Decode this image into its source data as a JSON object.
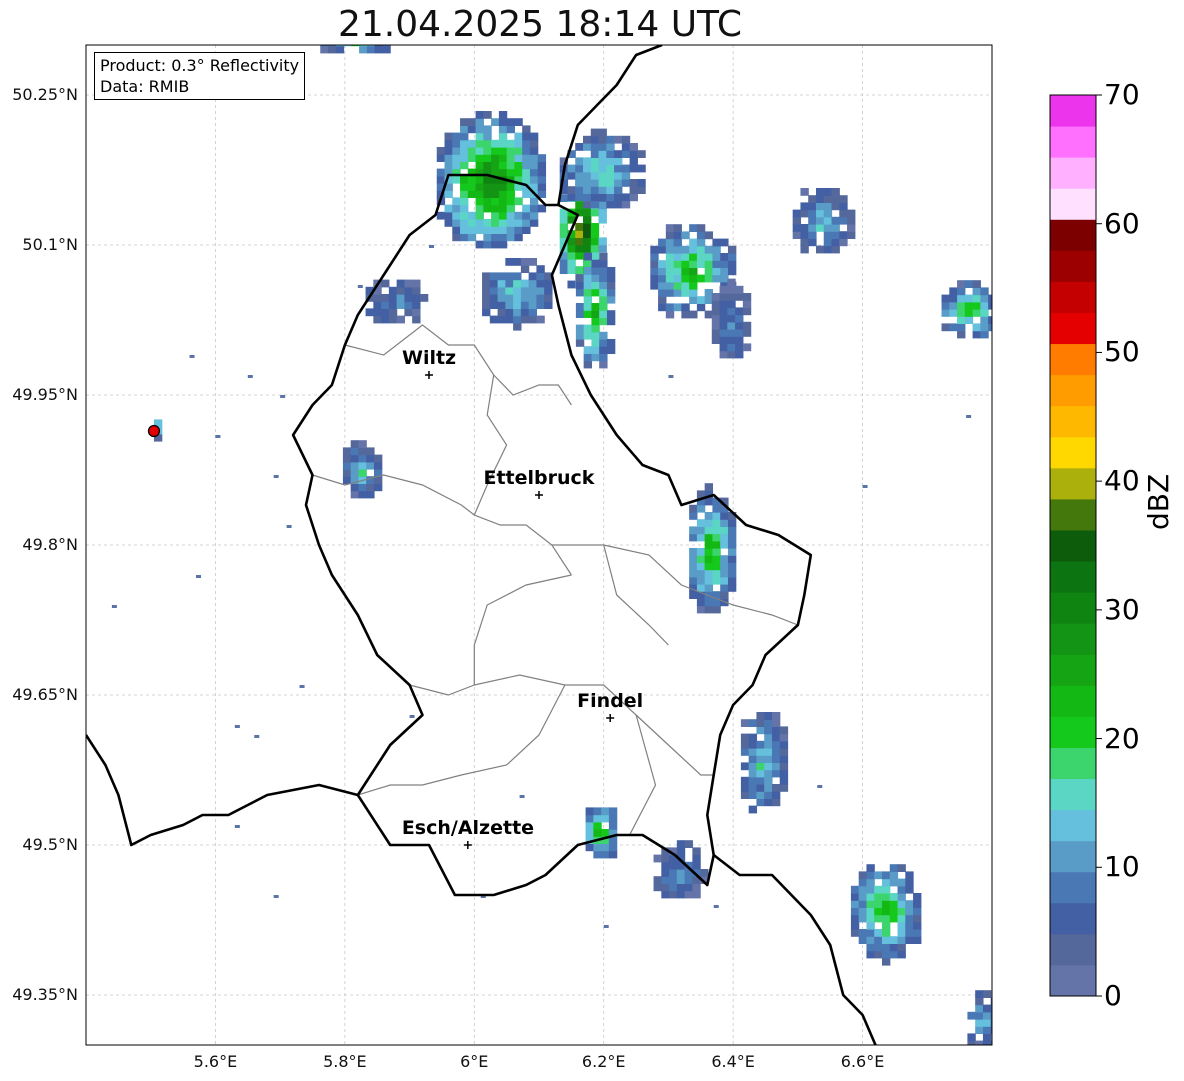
{
  "title": "21.04.2025 18:14 UTC",
  "info_box": {
    "product": "Product: 0.3° Reflectivity",
    "data_source": "Data: RMIB"
  },
  "axes": {
    "lat_labels": [
      "50.25°N",
      "50.1°N",
      "49.95°N",
      "49.8°N",
      "49.65°N",
      "49.5°N",
      "49.35°N"
    ],
    "lat_values": [
      50.25,
      50.1,
      49.95,
      49.8,
      49.65,
      49.5,
      49.35
    ],
    "lon_labels": [
      "5.6°E",
      "5.8°E",
      "6°E",
      "6.2°E",
      "6.4°E",
      "6.6°E"
    ],
    "lon_values": [
      5.6,
      5.8,
      6.0,
      6.2,
      6.4,
      6.6
    ],
    "lon_range": [
      5.4,
      6.8
    ],
    "lat_range": [
      49.3,
      50.3
    ],
    "grid": true
  },
  "cities": [
    {
      "name": "Wiltz",
      "lon": 5.93,
      "lat": 49.97
    },
    {
      "name": "Ettelbruck",
      "lon": 6.1,
      "lat": 49.85
    },
    {
      "name": "Findel",
      "lon": 6.21,
      "lat": 49.627
    },
    {
      "name": "Esch/Alzette",
      "lon": 5.99,
      "lat": 49.5
    }
  ],
  "radar_site": {
    "lon": 5.505,
    "lat": 49.914,
    "color": "#e00000"
  },
  "colorbar": {
    "label": "dBZ",
    "ticks": [
      "0",
      "10",
      "20",
      "30",
      "40",
      "50",
      "60",
      "70"
    ],
    "colors": [
      "#6474a8",
      "#54689c",
      "#4460a4",
      "#4a78b4",
      "#5a9cc8",
      "#64c0dc",
      "#5cd6c4",
      "#3cd46c",
      "#14c81c",
      "#14b814",
      "#14a414",
      "#149414",
      "#108410",
      "#0c7410",
      "#0c5c0c",
      "#44780c",
      "#acb00c",
      "#ffd800",
      "#ffb800",
      "#ff9c00",
      "#ff7c00",
      "#e40000",
      "#c40000",
      "#9c0000",
      "#7c0000",
      "#ffe0ff",
      "#ffb0ff",
      "#ff70ff",
      "#ec34ec"
    ]
  },
  "echo_cells": [
    {
      "lon": 6.02,
      "lat": 50.16,
      "rx": 0.09,
      "ry": 0.07,
      "max_dbz": 32
    },
    {
      "lon": 6.16,
      "lat": 50.11,
      "rx": 0.04,
      "ry": 0.06,
      "max_dbz": 40
    },
    {
      "lon": 6.19,
      "lat": 50.17,
      "rx": 0.07,
      "ry": 0.04,
      "max_dbz": 18
    },
    {
      "lon": 6.06,
      "lat": 50.05,
      "rx": 0.06,
      "ry": 0.035,
      "max_dbz": 16
    },
    {
      "lon": 6.18,
      "lat": 50.03,
      "rx": 0.035,
      "ry": 0.06,
      "max_dbz": 24
    },
    {
      "lon": 6.33,
      "lat": 50.07,
      "rx": 0.07,
      "ry": 0.05,
      "max_dbz": 24
    },
    {
      "lon": 6.39,
      "lat": 50.02,
      "rx": 0.035,
      "ry": 0.04,
      "max_dbz": 10
    },
    {
      "lon": 6.53,
      "lat": 50.12,
      "rx": 0.05,
      "ry": 0.035,
      "max_dbz": 14
    },
    {
      "lon": 6.76,
      "lat": 50.03,
      "rx": 0.05,
      "ry": 0.03,
      "max_dbz": 22
    },
    {
      "lon": 5.87,
      "lat": 50.04,
      "rx": 0.05,
      "ry": 0.025,
      "max_dbz": 10
    },
    {
      "lon": 5.82,
      "lat": 49.87,
      "rx": 0.035,
      "ry": 0.03,
      "max_dbz": 16
    },
    {
      "lon": 6.36,
      "lat": 49.79,
      "rx": 0.04,
      "ry": 0.065,
      "max_dbz": 24
    },
    {
      "lon": 6.44,
      "lat": 49.58,
      "rx": 0.04,
      "ry": 0.055,
      "max_dbz": 16
    },
    {
      "lon": 6.19,
      "lat": 49.51,
      "rx": 0.03,
      "ry": 0.03,
      "max_dbz": 24
    },
    {
      "lon": 6.31,
      "lat": 49.47,
      "rx": 0.045,
      "ry": 0.03,
      "max_dbz": 12
    },
    {
      "lon": 6.63,
      "lat": 49.43,
      "rx": 0.06,
      "ry": 0.05,
      "max_dbz": 24
    },
    {
      "lon": 6.78,
      "lat": 49.32,
      "rx": 0.03,
      "ry": 0.03,
      "max_dbz": 14
    },
    {
      "lon": 5.81,
      "lat": 50.3,
      "rx": 0.06,
      "ry": 0.015,
      "max_dbz": 18
    },
    {
      "lon": 5.505,
      "lat": 49.914,
      "rx": 0.012,
      "ry": 0.01,
      "max_dbz": 16
    }
  ],
  "speckles": [
    [
      5.56,
      49.99
    ],
    [
      5.65,
      49.97
    ],
    [
      5.7,
      49.95
    ],
    [
      5.6,
      49.91
    ],
    [
      5.69,
      49.87
    ],
    [
      5.71,
      49.82
    ],
    [
      5.57,
      49.77
    ],
    [
      5.44,
      49.74
    ],
    [
      5.63,
      49.62
    ],
    [
      5.66,
      49.61
    ],
    [
      5.73,
      49.66
    ],
    [
      5.63,
      49.52
    ],
    [
      5.69,
      49.45
    ],
    [
      5.9,
      49.63
    ],
    [
      6.07,
      49.55
    ],
    [
      6.01,
      49.45
    ],
    [
      6.2,
      49.42
    ],
    [
      6.37,
      49.44
    ],
    [
      6.53,
      49.56
    ],
    [
      6.76,
      49.93
    ],
    [
      6.6,
      49.86
    ],
    [
      6.38,
      49.84
    ],
    [
      6.3,
      49.97
    ],
    [
      5.82,
      50.06
    ],
    [
      5.93,
      50.1
    ]
  ],
  "borders": {
    "country": [
      [
        [
          5.4,
          49.61
        ],
        [
          5.43,
          49.58
        ],
        [
          5.45,
          49.55
        ],
        [
          5.47,
          49.5
        ],
        [
          5.5,
          49.51
        ],
        [
          5.55,
          49.52
        ],
        [
          5.58,
          49.53
        ],
        [
          5.62,
          49.53
        ],
        [
          5.68,
          49.55
        ],
        [
          5.76,
          49.56
        ],
        [
          5.82,
          49.55
        ],
        [
          5.87,
          49.5
        ],
        [
          5.93,
          49.5
        ],
        [
          5.97,
          49.45
        ],
        [
          6.03,
          49.45
        ],
        [
          6.08,
          49.46
        ],
        [
          6.11,
          49.47
        ],
        [
          6.16,
          49.5
        ],
        [
          6.22,
          49.51
        ],
        [
          6.26,
          49.51
        ],
        [
          6.31,
          49.49
        ],
        [
          6.36,
          49.46
        ],
        [
          6.37,
          49.49
        ],
        [
          6.41,
          49.47
        ],
        [
          6.46,
          49.47
        ],
        [
          6.52,
          49.43
        ],
        [
          6.55,
          49.4
        ],
        [
          6.57,
          49.35
        ],
        [
          6.6,
          49.33
        ],
        [
          6.62,
          49.3
        ]
      ],
      [
        [
          5.82,
          49.55
        ],
        [
          5.87,
          49.6
        ],
        [
          5.92,
          49.63
        ],
        [
          5.9,
          49.66
        ],
        [
          5.85,
          49.69
        ],
        [
          5.82,
          49.73
        ],
        [
          5.78,
          49.77
        ],
        [
          5.76,
          49.8
        ],
        [
          5.74,
          49.84
        ],
        [
          5.75,
          49.87
        ],
        [
          5.72,
          49.91
        ],
        [
          5.75,
          49.94
        ],
        [
          5.78,
          49.96
        ],
        [
          5.8,
          50.0
        ],
        [
          5.82,
          50.03
        ],
        [
          5.86,
          50.07
        ],
        [
          5.9,
          50.11
        ],
        [
          5.94,
          50.13
        ],
        [
          5.96,
          50.17
        ],
        [
          6.02,
          50.17
        ],
        [
          6.08,
          50.16
        ],
        [
          6.11,
          50.14
        ],
        [
          6.13,
          50.14
        ],
        [
          6.16,
          50.13
        ],
        [
          6.12,
          50.07
        ],
        [
          6.13,
          50.04
        ],
        [
          6.15,
          49.99
        ],
        [
          6.18,
          49.95
        ],
        [
          6.22,
          49.91
        ],
        [
          6.26,
          49.88
        ],
        [
          6.3,
          49.87
        ],
        [
          6.32,
          49.84
        ],
        [
          6.37,
          49.85
        ],
        [
          6.42,
          49.82
        ],
        [
          6.47,
          49.81
        ],
        [
          6.52,
          49.79
        ],
        [
          6.51,
          49.75
        ],
        [
          6.5,
          49.72
        ],
        [
          6.45,
          49.69
        ],
        [
          6.43,
          49.66
        ],
        [
          6.4,
          49.64
        ],
        [
          6.38,
          49.61
        ],
        [
          6.37,
          49.57
        ],
        [
          6.36,
          49.53
        ],
        [
          6.37,
          49.49
        ]
      ],
      [
        [
          6.13,
          50.14
        ],
        [
          6.14,
          50.18
        ],
        [
          6.16,
          50.22
        ],
        [
          6.19,
          50.24
        ],
        [
          6.22,
          50.26
        ],
        [
          6.25,
          50.29
        ],
        [
          6.29,
          50.3
        ]
      ]
    ],
    "cantons": [
      [
        [
          5.8,
          50.0
        ],
        [
          5.86,
          49.99
        ],
        [
          5.92,
          50.02
        ],
        [
          5.96,
          50.0
        ],
        [
          6.0,
          50.0
        ],
        [
          6.03,
          49.97
        ],
        [
          6.06,
          49.95
        ],
        [
          6.1,
          49.96
        ],
        [
          6.13,
          49.96
        ],
        [
          6.15,
          49.94
        ]
      ],
      [
        [
          6.03,
          49.97
        ],
        [
          6.02,
          49.93
        ],
        [
          6.05,
          49.9
        ],
        [
          6.02,
          49.86
        ],
        [
          6.0,
          49.83
        ],
        [
          6.04,
          49.82
        ],
        [
          6.08,
          49.82
        ],
        [
          6.12,
          49.8
        ],
        [
          6.15,
          49.77
        ]
      ],
      [
        [
          5.75,
          49.87
        ],
        [
          5.8,
          49.86
        ],
        [
          5.86,
          49.87
        ],
        [
          5.92,
          49.86
        ],
        [
          5.98,
          49.84
        ],
        [
          6.0,
          49.83
        ]
      ],
      [
        [
          6.12,
          49.8
        ],
        [
          6.2,
          49.8
        ],
        [
          6.27,
          49.79
        ],
        [
          6.32,
          49.76
        ],
        [
          6.4,
          49.74
        ],
        [
          6.46,
          49.73
        ],
        [
          6.5,
          49.72
        ]
      ],
      [
        [
          6.15,
          49.77
        ],
        [
          6.08,
          49.76
        ],
        [
          6.02,
          49.74
        ],
        [
          6.0,
          49.7
        ],
        [
          6.0,
          49.66
        ],
        [
          6.07,
          49.67
        ],
        [
          6.14,
          49.66
        ],
        [
          6.2,
          49.66
        ],
        [
          6.25,
          49.63
        ],
        [
          6.3,
          49.6
        ],
        [
          6.35,
          49.57
        ],
        [
          6.37,
          49.57
        ]
      ],
      [
        [
          5.9,
          49.66
        ],
        [
          5.96,
          49.65
        ],
        [
          6.0,
          49.66
        ]
      ],
      [
        [
          6.14,
          49.66
        ],
        [
          6.1,
          49.61
        ],
        [
          6.05,
          49.58
        ],
        [
          5.98,
          49.57
        ],
        [
          5.92,
          49.56
        ],
        [
          5.87,
          49.56
        ],
        [
          5.82,
          49.55
        ]
      ],
      [
        [
          6.25,
          49.63
        ],
        [
          6.28,
          49.56
        ],
        [
          6.24,
          49.51
        ]
      ],
      [
        [
          6.2,
          49.8
        ],
        [
          6.22,
          49.75
        ],
        [
          6.27,
          49.72
        ],
        [
          6.3,
          49.7
        ]
      ]
    ]
  }
}
